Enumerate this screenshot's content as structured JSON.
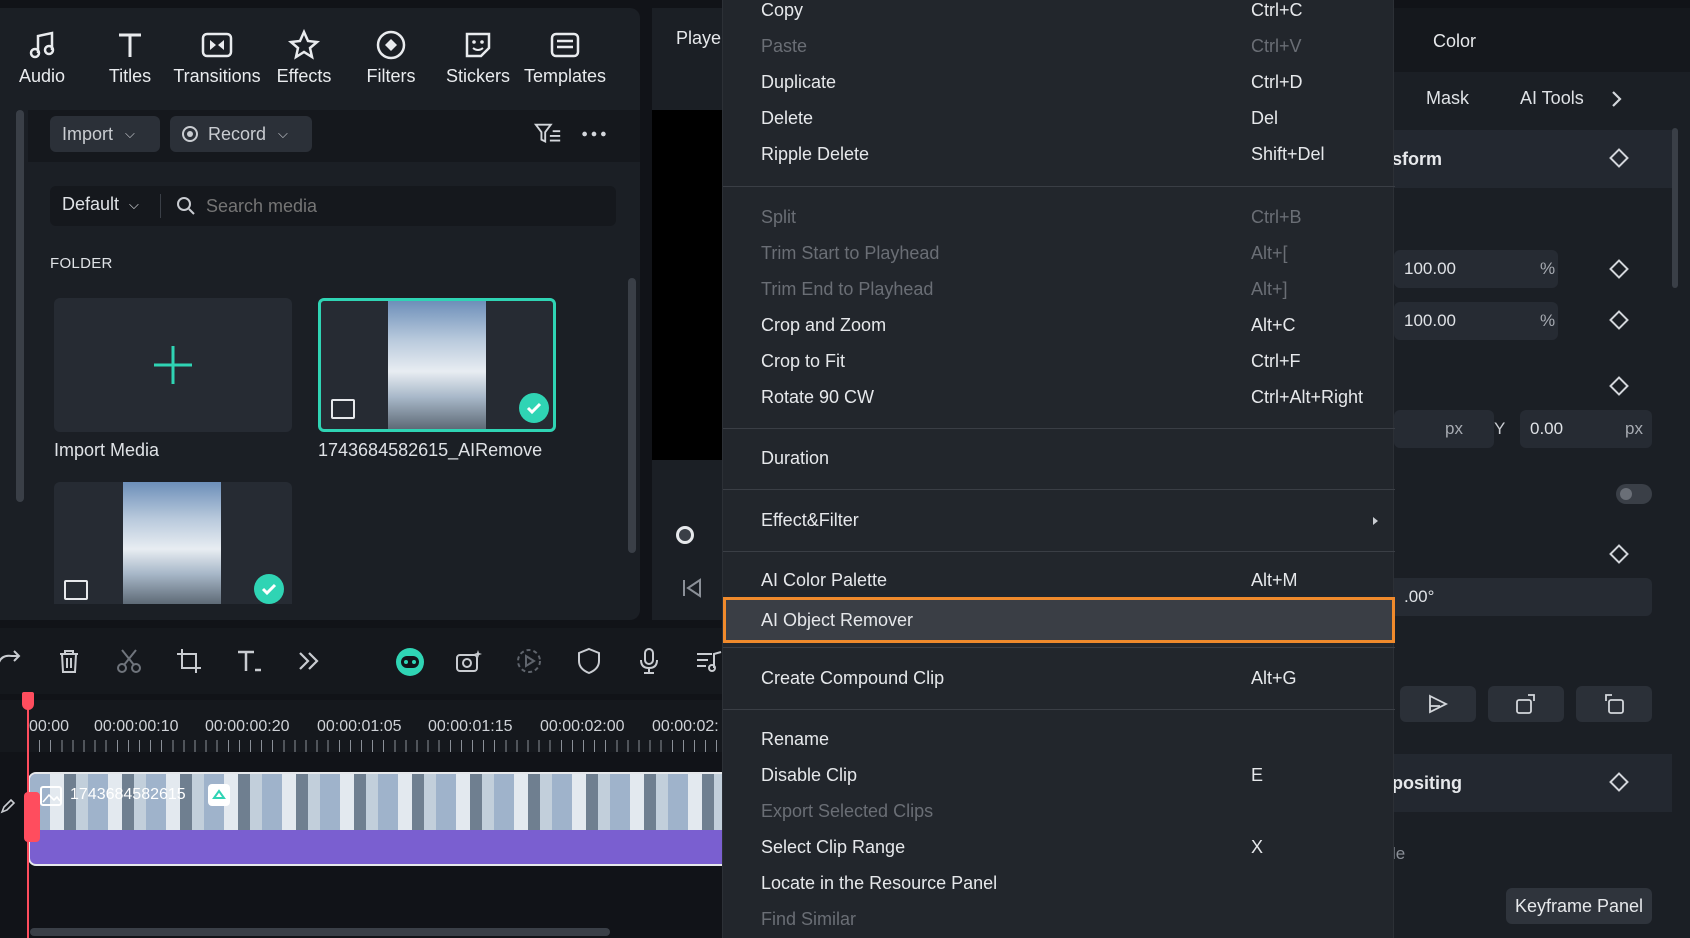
{
  "media_panel": {
    "tabs": [
      {
        "label": "Audio",
        "icon": "music-note-icon"
      },
      {
        "label": "Titles",
        "icon": "title-t-icon"
      },
      {
        "label": "Transitions",
        "icon": "transition-icon"
      },
      {
        "label": "Effects",
        "icon": "effects-star-icon"
      },
      {
        "label": "Filters",
        "icon": "filter-icon"
      },
      {
        "label": "Stickers",
        "icon": "sticker-icon"
      },
      {
        "label": "Templates",
        "icon": "template-icon"
      }
    ],
    "import_label": "Import",
    "record_label": "Record",
    "sort_label": "Default",
    "search_placeholder": "Search media",
    "folder_label": "FOLDER",
    "items": [
      {
        "caption": "Import Media"
      },
      {
        "caption": "1743684582615_AIRemove"
      },
      {
        "caption": ""
      }
    ]
  },
  "player": {
    "title": "Player"
  },
  "timeline": {
    "ticks": [
      "00:00",
      "00:00:00:10",
      "00:00:00:20",
      "00:00:01:05",
      "00:00:01:15",
      "00:00:02:00",
      "00:00:02:"
    ],
    "clip_label": "1743684582615"
  },
  "context_menu": {
    "groups": [
      [
        {
          "label": "Copy",
          "shortcut": "Ctrl+C",
          "disabled": false
        },
        {
          "label": "Paste",
          "shortcut": "Ctrl+V",
          "disabled": true
        },
        {
          "label": "Duplicate",
          "shortcut": "Ctrl+D",
          "disabled": false
        },
        {
          "label": "Delete",
          "shortcut": "Del",
          "disabled": false
        },
        {
          "label": "Ripple Delete",
          "shortcut": "Shift+Del",
          "disabled": false
        }
      ],
      [
        {
          "label": "Split",
          "shortcut": "Ctrl+B",
          "disabled": true
        },
        {
          "label": "Trim Start to Playhead",
          "shortcut": "Alt+[",
          "disabled": true
        },
        {
          "label": "Trim End to Playhead",
          "shortcut": "Alt+]",
          "disabled": true
        },
        {
          "label": "Crop and Zoom",
          "shortcut": "Alt+C",
          "disabled": false
        },
        {
          "label": "Crop to Fit",
          "shortcut": "Ctrl+F",
          "disabled": false
        },
        {
          "label": "Rotate 90 CW",
          "shortcut": "Ctrl+Alt+Right",
          "disabled": false
        }
      ],
      [
        {
          "label": "Duration",
          "shortcut": "",
          "disabled": false
        }
      ],
      [
        {
          "label": "Effect&Filter",
          "shortcut": "",
          "disabled": false,
          "submenu": true
        }
      ],
      [
        {
          "label": "AI Color Palette",
          "shortcut": "Alt+M",
          "disabled": false
        },
        {
          "label": "AI Object Remover",
          "shortcut": "",
          "disabled": false,
          "highlight": true
        }
      ],
      [
        {
          "label": "Create Compound Clip",
          "shortcut": "Alt+G",
          "disabled": false
        }
      ],
      [
        {
          "label": "Rename",
          "shortcut": "",
          "disabled": false
        },
        {
          "label": "Disable Clip",
          "shortcut": "E",
          "disabled": false
        },
        {
          "label": "Export Selected Clips",
          "shortcut": "",
          "disabled": true
        },
        {
          "label": "Select Clip Range",
          "shortcut": "X",
          "disabled": false
        },
        {
          "label": "Locate in the Resource Panel",
          "shortcut": "",
          "disabled": false
        },
        {
          "label": "Find Similar",
          "shortcut": "",
          "disabled": true
        }
      ]
    ]
  },
  "properties": {
    "tab_color": "Color",
    "tab_mask": "Mask",
    "tab_ai_tools": "AI Tools",
    "transform_title": "sform",
    "scale_x": "100.00",
    "scale_y": "100.00",
    "percent": "%",
    "pos_x_unit": "px",
    "pos_y_label": "Y",
    "pos_y_value": "0.00",
    "pos_y_unit": "px",
    "rotation_value": ".00°",
    "compositing_title": "positing",
    "blend_label_partial": "le",
    "keyframe_panel_label": "Keyframe Panel"
  },
  "colors": {
    "accent": "#2fd4b4",
    "highlight_border": "#f08a2c",
    "playhead": "#ff4d5e",
    "clip_audio": "#7a5fd0"
  }
}
